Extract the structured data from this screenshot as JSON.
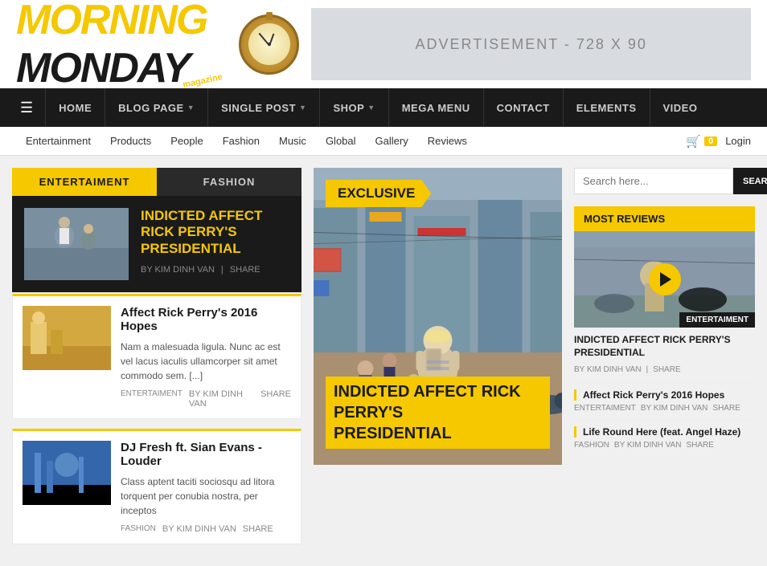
{
  "logo": {
    "morning": "MORNING",
    "monday": "MONDAY",
    "magazine": "magazine"
  },
  "ad": {
    "text": "ADVERTISEMENT - 728 X 90"
  },
  "navbar": {
    "hamburger": "☰",
    "items": [
      {
        "label": "HOME",
        "hasArrow": false
      },
      {
        "label": "BLOG PAGE",
        "hasArrow": true
      },
      {
        "label": "SINGLE POST",
        "hasArrow": true
      },
      {
        "label": "SHOP",
        "hasArrow": true
      },
      {
        "label": "MEGA MENU",
        "hasArrow": false
      },
      {
        "label": "CONTACT",
        "hasArrow": false
      },
      {
        "label": "ELEMENTS",
        "hasArrow": false
      },
      {
        "label": "VIDEO",
        "hasArrow": false
      }
    ]
  },
  "subnav": {
    "items": [
      "Entertainment",
      "Products",
      "People",
      "Fashion",
      "Music",
      "Global",
      "Gallery",
      "Reviews"
    ],
    "cart_count": "0",
    "login_label": "Login"
  },
  "left": {
    "tab1": "ENTERTAIMENT",
    "tab2": "FASHION",
    "featured_title": "INDICTED AFFECT RICK PERRY'S PRESIDENTIAL",
    "featured_by": "BY KIM DINH VAN",
    "featured_share": "SHARE",
    "article1_title": "Affect Rick Perry's 2016 Hopes",
    "article1_text": "Nam a malesuada ligula. Nunc ac est vel lacus iaculis ullamcorper sit amet commodo sem. [...]",
    "article1_cat": "ENTERTAIMENT",
    "article1_by": "BY KIM DINH VAN",
    "article1_share": "SHARE",
    "article2_title": "DJ Fresh ft. Sian Evans - Louder",
    "article2_text": "Class aptent taciti sociosqu ad litora torquent per conubia nostra, per inceptos",
    "article2_cat": "FASHION",
    "article2_by": "BY KIM DINH VAN",
    "article2_share": "SHARE"
  },
  "middle": {
    "badge": "EXCLUSIVE",
    "headline_line1": "INDICTED AFFECT RICK PERRY'S",
    "headline_line2": "PRESIDENTIAL"
  },
  "right": {
    "search_placeholder": "Search here...",
    "search_btn": "SEARCH",
    "most_reviews": "MOST REVIEWS",
    "entertain_badge": "ENTERTAIMENT",
    "review1_title": "INDICTED AFFECT RICK PERRY'S PRESIDENTIAL",
    "review1_by": "BY KIM DINH VAN",
    "review1_share": "SHARE",
    "review2_title": "Affect Rick Perry's 2016 Hopes",
    "review2_cat": "ENTERTAIMENT",
    "review2_by": "BY KIM DINH VAN",
    "review2_share": "SHARE",
    "review3_title": "Life Round Here (feat. Angel Haze)",
    "review3_cat": "FASHION",
    "review3_by": "BY KIM DINH VAN",
    "review3_share": "SHARE"
  }
}
